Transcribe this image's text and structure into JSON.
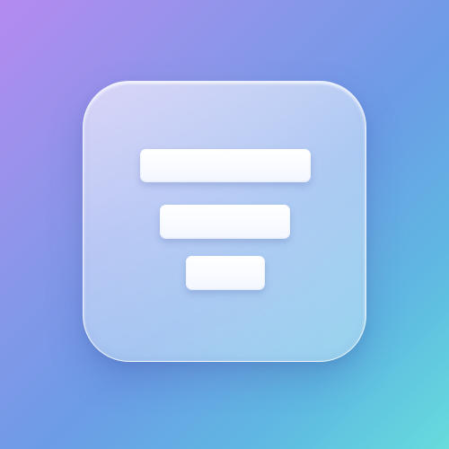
{
  "icon": {
    "name": "filter-icon",
    "glyph": "filter"
  },
  "colors": {
    "background_start": "#b58af0",
    "background_mid": "#6c9ce6",
    "background_end": "#66dcdc",
    "glass": "#eef5ff",
    "bar": "#ffffff"
  }
}
